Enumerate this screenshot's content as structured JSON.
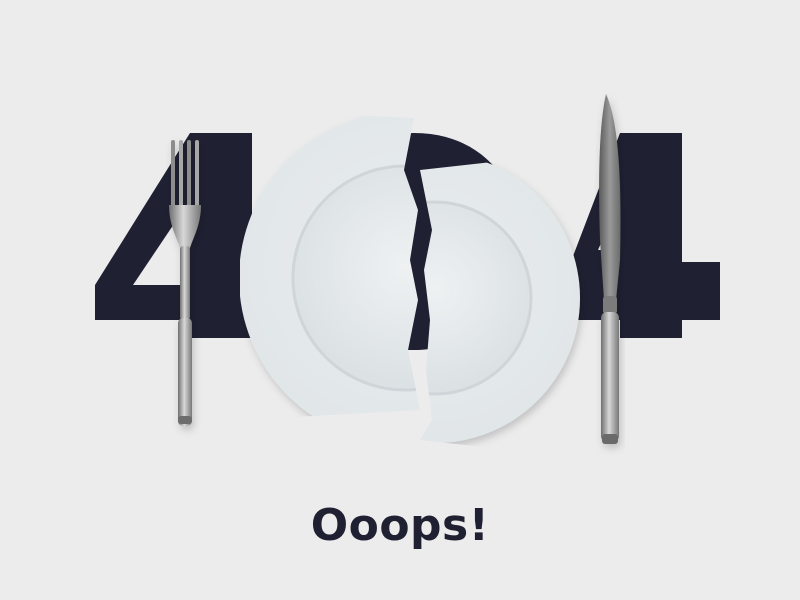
{
  "error_graphic": {
    "code": "404",
    "digit_left": "4",
    "digit_middle": "0",
    "digit_right": "4"
  },
  "message": "Ooops!",
  "illustration": {
    "left_utensil": "fork-icon",
    "center_object": "broken-plate",
    "right_utensil": "knife-icon"
  },
  "colors": {
    "background": "#ececec",
    "digit": "#1f2133",
    "plate": "#e6eaec",
    "plate_shadow": "#c8ced2",
    "silverware": "#9a9a9a"
  }
}
